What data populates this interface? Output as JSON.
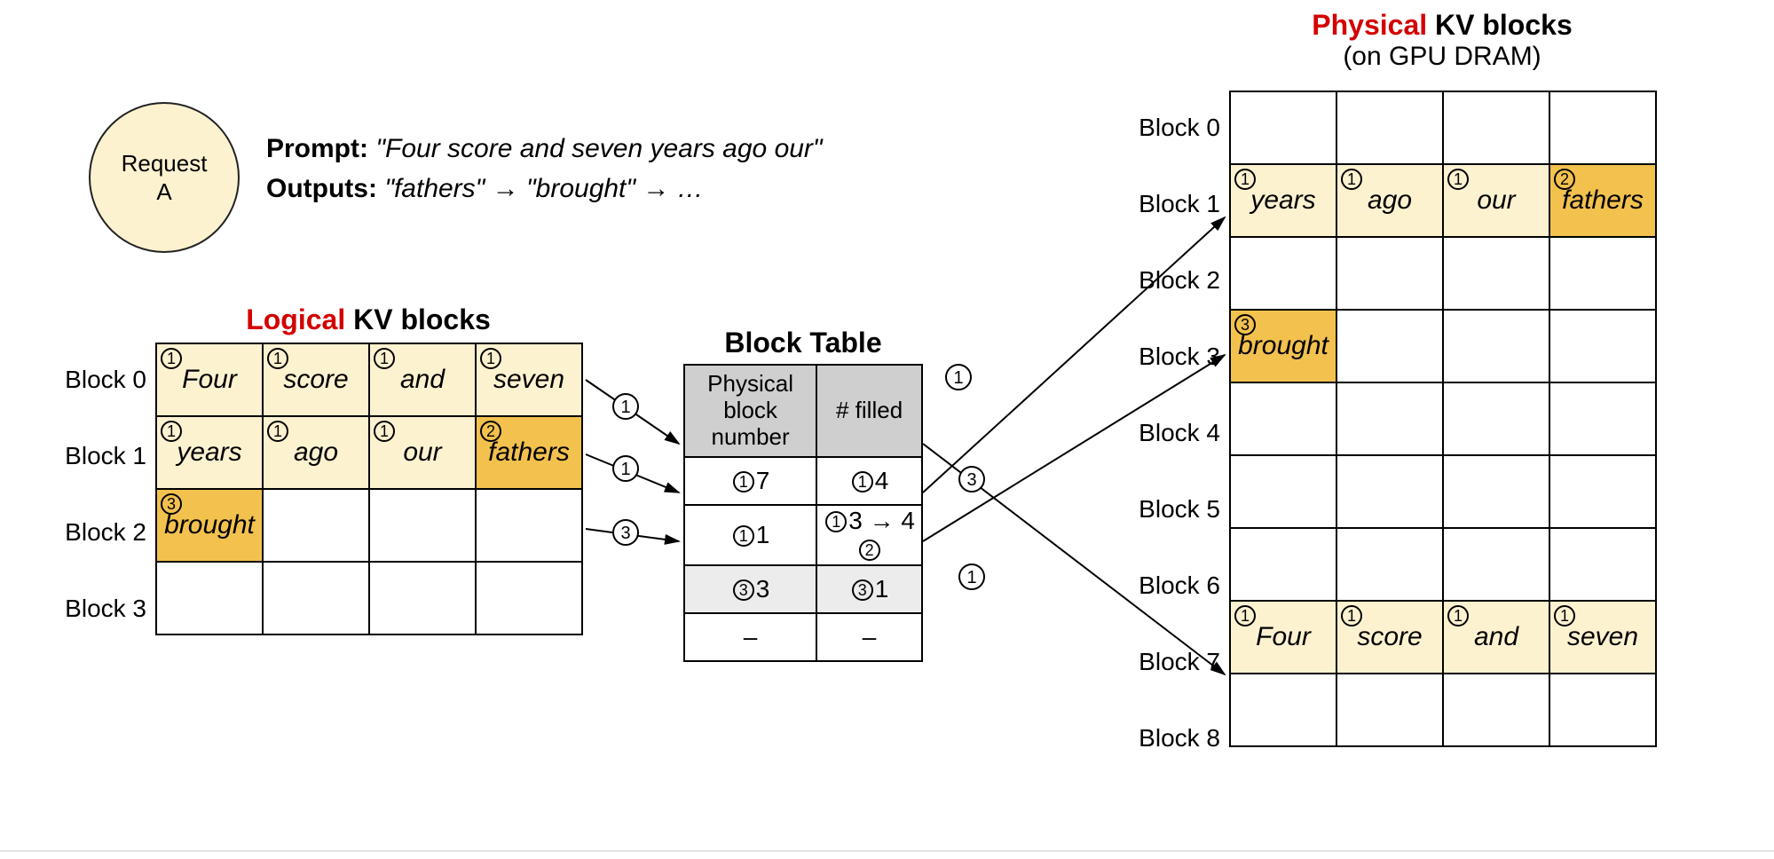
{
  "request": {
    "line1": "Request",
    "line2": "A"
  },
  "prompt": {
    "label": "Prompt:",
    "text": "\"Four score and seven years ago our\"",
    "outputs_label": "Outputs:",
    "outputs_text": "\"fathers\" → \"brought\" → …"
  },
  "titles": {
    "logical_red": "Logical",
    "logical_rest": " KV blocks",
    "physical_red": "Physical",
    "physical_rest": " KV blocks",
    "physical_sub": "(on GPU DRAM)",
    "block_table": "Block Table"
  },
  "bt_headers": {
    "col0": "Physical block\nnumber",
    "col1": "# filled"
  },
  "bt_rows": [
    {
      "col0_step": "1",
      "col0_val": "7",
      "col1_step": "1",
      "col1_val": "4"
    },
    {
      "col0_step": "1",
      "col0_val": "1",
      "col1_step_a": "1",
      "col1_val_a": "3",
      "col1_arrow": "→",
      "col1_val_b": "4",
      "col1_step_b": "2"
    },
    {
      "col0_step": "3",
      "col0_val": "3",
      "col1_step": "3",
      "col1_val": "1",
      "light": true
    },
    {
      "col0_val": "–",
      "col1_val": "–"
    }
  ],
  "logical_rows": [
    "Block 0",
    "Block 1",
    "Block 2",
    "Block 3"
  ],
  "logical_cells": [
    [
      {
        "t": "Four",
        "s": "1",
        "bg": "bg1"
      },
      {
        "t": "score",
        "s": "1",
        "bg": "bg1"
      },
      {
        "t": "and",
        "s": "1",
        "bg": "bg1"
      },
      {
        "t": "seven",
        "s": "1",
        "bg": "bg1"
      }
    ],
    [
      {
        "t": "years",
        "s": "1",
        "bg": "bg1"
      },
      {
        "t": "ago",
        "s": "1",
        "bg": "bg1"
      },
      {
        "t": "our",
        "s": "1",
        "bg": "bg1"
      },
      {
        "t": "fathers",
        "s": "2",
        "bg": "bg2"
      }
    ],
    [
      {
        "t": "brought",
        "s": "3",
        "bg": "bg3"
      },
      {},
      {},
      {}
    ],
    [
      {},
      {},
      {},
      {}
    ]
  ],
  "physical_rows": [
    "Block 0",
    "Block 1",
    "Block 2",
    "Block 3",
    "Block 4",
    "Block 5",
    "Block 6",
    "Block 7",
    "Block 8"
  ],
  "physical_cells": [
    [
      {},
      {},
      {},
      {}
    ],
    [
      {
        "t": "years",
        "s": "1",
        "bg": "bg1"
      },
      {
        "t": "ago",
        "s": "1",
        "bg": "bg1"
      },
      {
        "t": "our",
        "s": "1",
        "bg": "bg1"
      },
      {
        "t": "fathers",
        "s": "2",
        "bg": "bg2"
      }
    ],
    [
      {},
      {},
      {},
      {}
    ],
    [
      {
        "t": "brought",
        "s": "3",
        "bg": "bg3"
      },
      {},
      {},
      {}
    ],
    [
      {},
      {},
      {},
      {}
    ],
    [
      {},
      {},
      {},
      {}
    ],
    [
      {},
      {},
      {},
      {}
    ],
    [
      {
        "t": "Four",
        "s": "1",
        "bg": "bg1"
      },
      {
        "t": "score",
        "s": "1",
        "bg": "bg1"
      },
      {
        "t": "and",
        "s": "1",
        "bg": "bg1"
      },
      {
        "t": "seven",
        "s": "1",
        "bg": "bg1"
      }
    ],
    [
      {},
      {},
      {},
      {}
    ]
  ],
  "arrow_steps": {
    "l0": "1",
    "l1": "1",
    "l2": "3",
    "r0": "1",
    "r1": "3",
    "r2": "1"
  }
}
